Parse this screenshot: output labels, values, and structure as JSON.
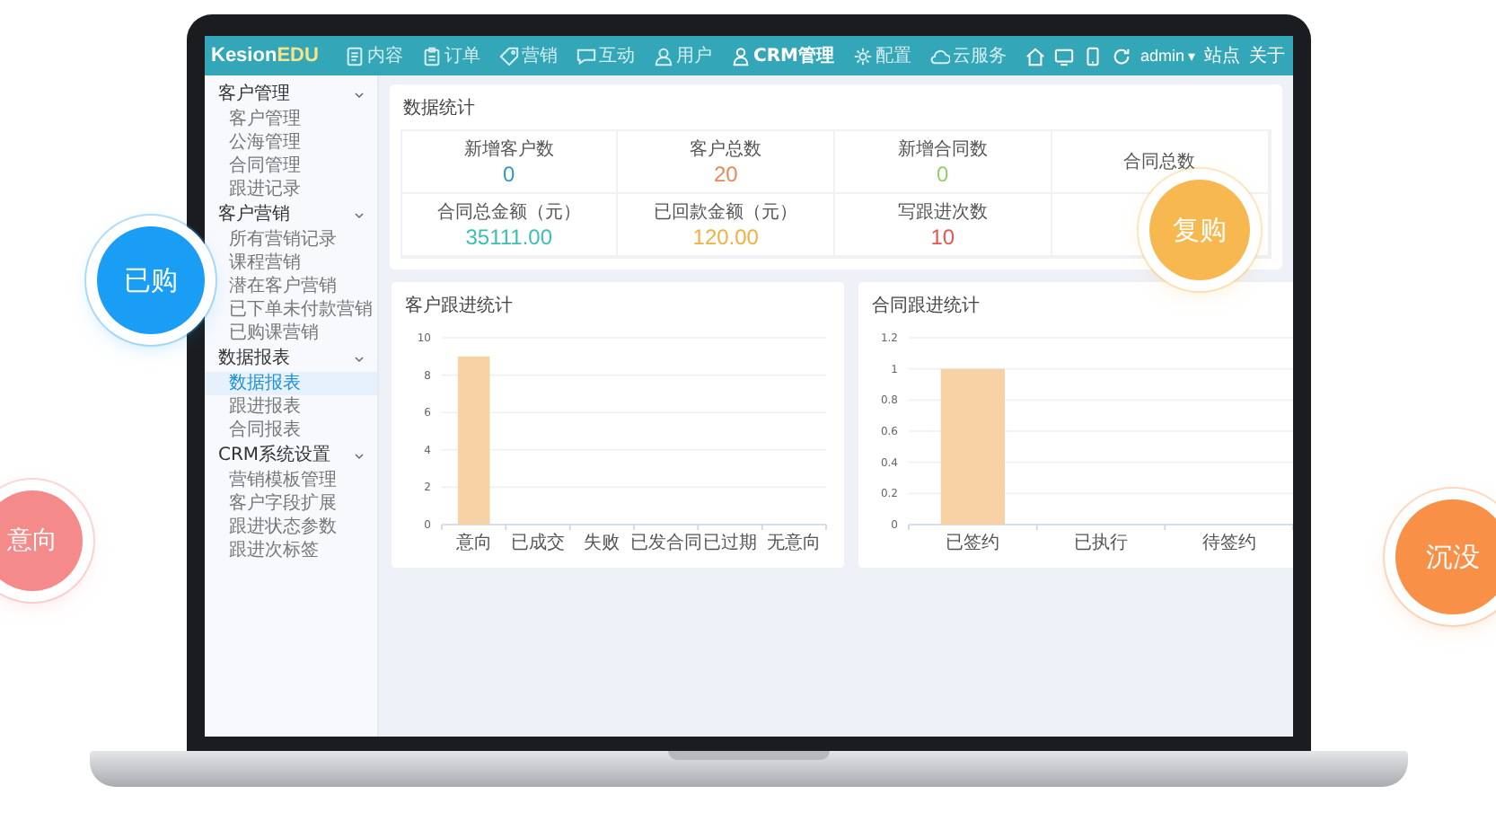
{
  "nav": {
    "logo": "Kesion",
    "logo_accent": "EDU",
    "items": [
      {
        "label": "内容",
        "selected": false
      },
      {
        "label": "订单",
        "selected": false
      },
      {
        "label": "营销",
        "selected": false
      },
      {
        "label": "互动",
        "selected": false
      },
      {
        "label": "用户",
        "selected": false
      },
      {
        "label": "CRM管理",
        "selected": true
      },
      {
        "label": "配置",
        "selected": false
      },
      {
        "label": "云服务",
        "selected": false
      }
    ],
    "user": "admin",
    "caret": "▾",
    "links": [
      "站点",
      "关于"
    ]
  },
  "sidebar": {
    "groups": [
      {
        "label": "客户管理",
        "expanded": true,
        "children": [
          {
            "label": "客户管理",
            "selected": false
          },
          {
            "label": "公海管理",
            "selected": false
          },
          {
            "label": "合同管理",
            "selected": false
          },
          {
            "label": "跟进记录",
            "selected": false
          }
        ]
      },
      {
        "label": "客户营销",
        "expanded": true,
        "children": [
          {
            "label": "所有营销记录",
            "selected": false
          },
          {
            "label": "课程营销",
            "selected": false
          },
          {
            "label": "潜在客户营销",
            "selected": false
          },
          {
            "label": "已下单未付款营销",
            "selected": false
          },
          {
            "label": "已购课营销",
            "selected": false
          }
        ]
      },
      {
        "label": "数据报表",
        "expanded": true,
        "children": [
          {
            "label": "数据报表",
            "selected": true
          },
          {
            "label": "跟进报表",
            "selected": false
          },
          {
            "label": "合同报表",
            "selected": false
          }
        ]
      },
      {
        "label": "CRM系统设置",
        "expanded": true,
        "children": [
          {
            "label": "营销模板管理",
            "selected": false
          },
          {
            "label": "客户字段扩展",
            "selected": false
          },
          {
            "label": "跟进状态参数",
            "selected": false
          },
          {
            "label": "跟进次标签",
            "selected": false
          }
        ]
      }
    ]
  },
  "stats": {
    "title": "数据统计",
    "cells": [
      {
        "label": "新增客户数",
        "value": "0",
        "color": "#2b9bbf"
      },
      {
        "label": "客户总数",
        "value": "20",
        "color": "#e8875a"
      },
      {
        "label": "新增合同数",
        "value": "0",
        "color": "#8fd16a"
      },
      {
        "label": "合同总数"
      },
      {
        "label": "合同总金额（元）",
        "value": "35111.00",
        "color": "#3bbfb0"
      },
      {
        "label": "已回款金额（元）",
        "value": "120.00",
        "color": "#f0b040"
      },
      {
        "label": "写跟进次数",
        "value": "10",
        "color": "#e8544a"
      }
    ]
  },
  "charts": [
    {
      "title": "客户跟进统计",
      "chart_data": {
        "type": "bar",
        "categories": [
          "意向",
          "已成交",
          "失败",
          "已发合同",
          "已过期",
          "无意向"
        ],
        "series": [
          {
            "color": "#f6d2a4",
            "values": [
              9,
              0,
              0,
              0,
              0,
              0
            ]
          }
        ],
        "grid": true,
        "ylim": [
          0,
          10
        ],
        "yticks": [
          0,
          2,
          4,
          6,
          8,
          10
        ]
      }
    },
    {
      "title": "合同跟进统计",
      "chart_data": {
        "type": "bar",
        "categories": [
          "已签约",
          "已执行",
          "待签约"
        ],
        "series": [
          {
            "color": "#f6d2a4",
            "values": [
              1,
              0,
              0
            ]
          }
        ],
        "grid": true,
        "ylim": [
          0,
          1.2
        ],
        "yticks": [
          0,
          0.2,
          0.4,
          0.6,
          0.8,
          1,
          1.2
        ]
      }
    }
  ],
  "bubbles": [
    {
      "label": "已购",
      "color": "#1a9ef5"
    },
    {
      "label": "意向",
      "color": "#f58a8a"
    },
    {
      "label": "复购",
      "color": "#f8b850"
    },
    {
      "label": "沉没",
      "color": "#f89048"
    }
  ]
}
